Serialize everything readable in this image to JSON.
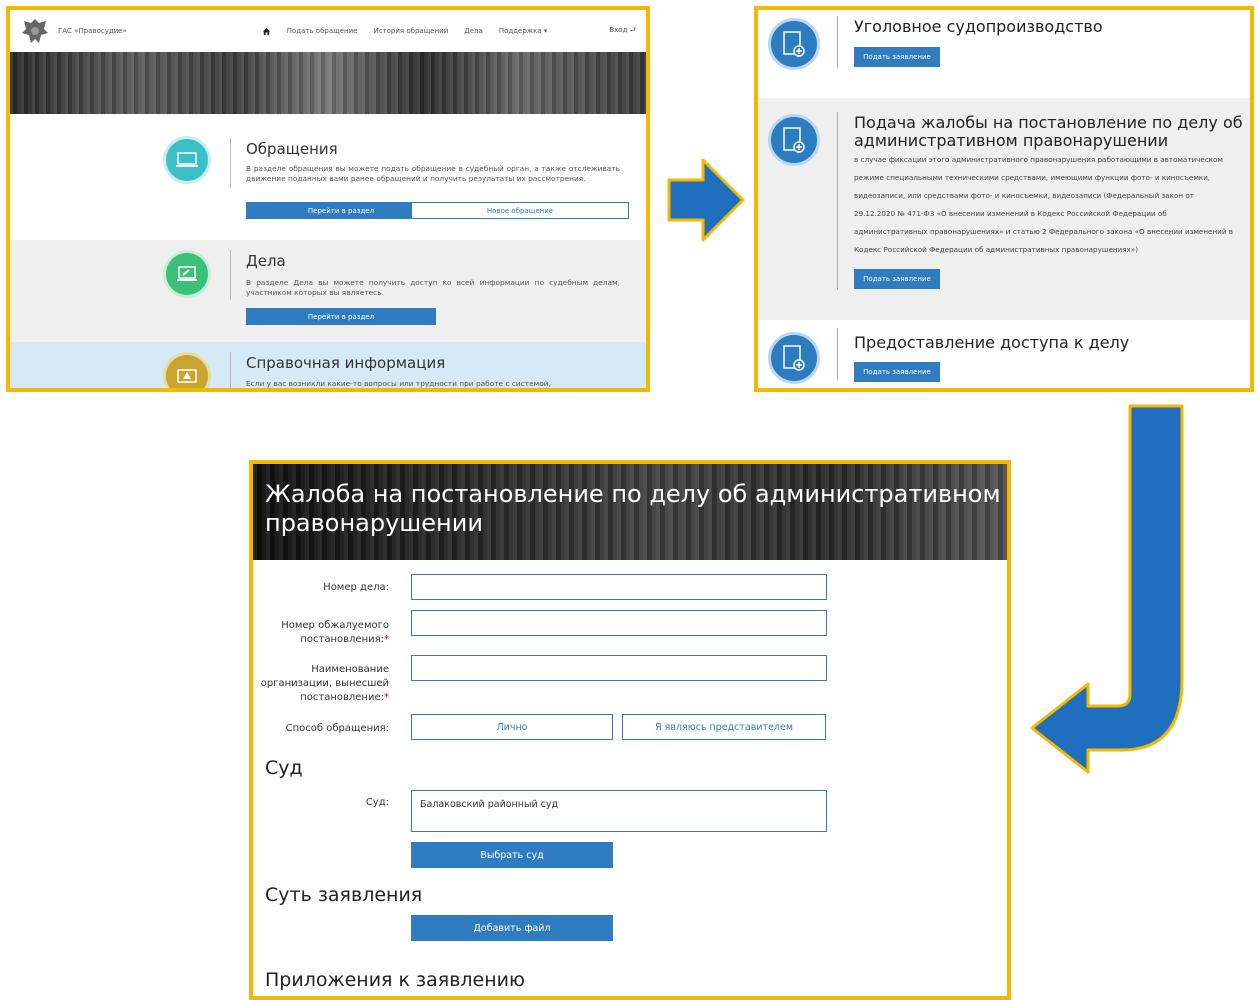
{
  "colors": {
    "frame": "#f5b800",
    "accent": "#2f7dc0",
    "arrow": "#1f6fbe"
  },
  "panel1": {
    "site_name": "ГАС «Правосудие»",
    "nav": {
      "home_icon": "home-icon",
      "items": [
        "Подать обращение",
        "История обращений",
        "Дела",
        "Поддержка ▾"
      ],
      "login": "Вход"
    },
    "sections": [
      {
        "title": "Обращения",
        "text": "В разделе обращения вы можете подать обращение в судебный орган, а также отслеживать движение поданных вами ранее обращений и получить результаты их рассмотрения.",
        "btn_primary": "Перейти в раздел",
        "btn_secondary": "Новое обращение",
        "icon": "laptop-icon"
      },
      {
        "title": "Дела",
        "text": "В разделе Дела вы можете получить доступ ко всей информации по судебным делам, участником которых вы являетесь.",
        "btn_primary": "Перейти в раздел",
        "icon": "gavel-icon"
      },
      {
        "title": "Справочная информация",
        "text": "Если у вас возникли какие-то вопросы или трудности при работе с системой,",
        "icon": "warning-icon"
      }
    ]
  },
  "panel2": {
    "items": [
      {
        "title": "Уголовное судопроизводство",
        "button": "Подать заявление"
      },
      {
        "title": "Подача жалобы на постановление по делу об административном правонарушении",
        "description": "в случае фиксации этого административного правонарушения работающими в автоматическом режиме специальными техническими средствами, имеющими функции фото- и киносъемки, видеозаписи, или средствами фото- и киносъемки, видеозаписи (Федеральный закон от 29.12.2020 № 471-ФЗ «О внесении изменений в Кодекс Российской Федерации об административных правонарушениях» и статью 2 Федерального закона «О внесении изменений в Кодекс Российской Федерации об административных правонарушениях»)",
        "button": "Подать заявление"
      },
      {
        "title": "Предоставление доступа к делу",
        "button": "Подать заявление"
      }
    ]
  },
  "panel3": {
    "title": "Жалоба на постановление по делу об административном правонарушении",
    "fields": {
      "case_number": "Номер дела:",
      "decision_number": "Номер обжалуемого постановления:",
      "organization": "Наименование организации, вынесшей постановление:",
      "method": "Способ обращения:"
    },
    "required_mark": "*",
    "method_options": [
      "Лично",
      "Я являюсь представителем"
    ],
    "court_section": "Суд",
    "court_label": "Суд:",
    "court_value": "Балаковский районный суд",
    "choose_court": "Выбрать суд",
    "essence_section": "Суть заявления",
    "add_file": "Добавить файл",
    "attachments_section": "Приложения к заявлению"
  }
}
